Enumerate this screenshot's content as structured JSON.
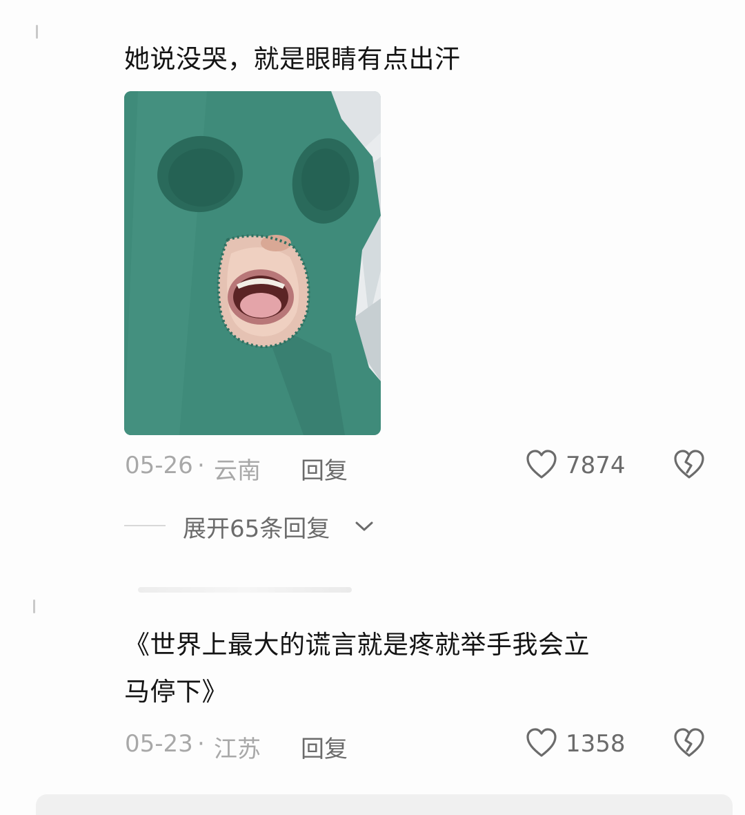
{
  "comments": [
    {
      "text": "她说没哭，就是眼睛有点出汗",
      "date": "05-26",
      "location": "云南",
      "reply_label": "回复",
      "likes": "7874",
      "expand_label": "展开65条回复"
    },
    {
      "text_line1": "《世界上最大的谎言就是疼就举手我会立",
      "text_line2": "马停下》",
      "date": "05-23",
      "location": "江苏",
      "reply_label": "回复",
      "likes": "1358"
    }
  ],
  "icons": {
    "like": "heart-outline-icon",
    "dislike": "broken-heart-icon",
    "expand": "chevron-down-icon"
  },
  "colors": {
    "text": "#141414",
    "meta": "#a8a8a8",
    "action": "#6b6b6b",
    "photo_cloth": "#3f8b7a"
  }
}
